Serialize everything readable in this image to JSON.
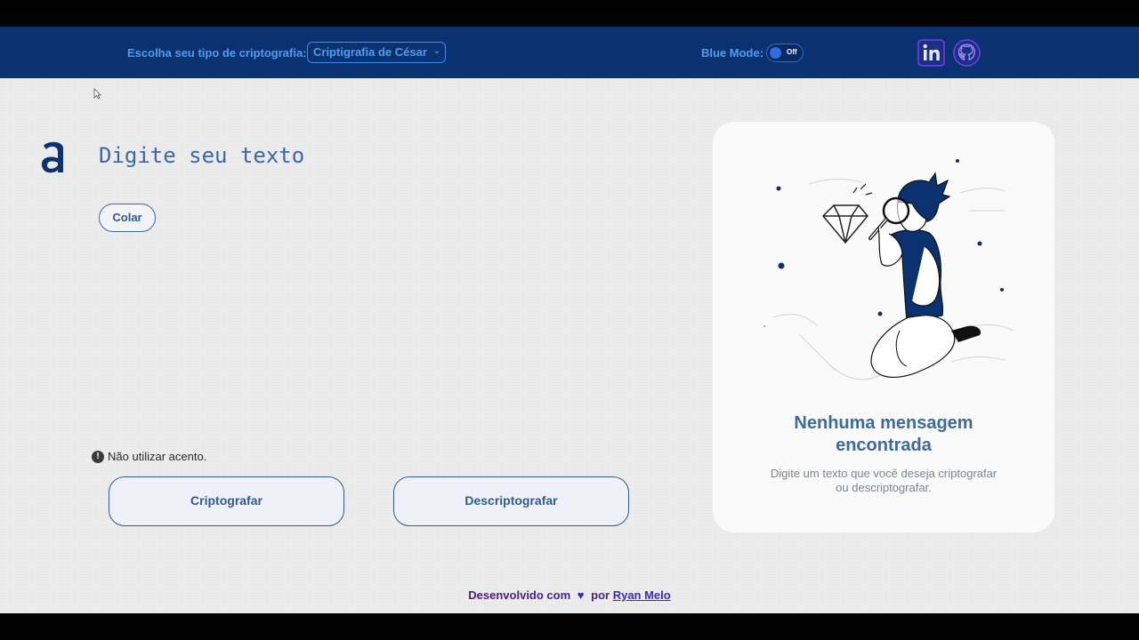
{
  "header": {
    "crypto_label": "Escolha seu tipo de criptografia:",
    "crypto_selected": "Criptigrafia de César",
    "blue_mode_label": "Blue Mode:",
    "toggle_state": "Off"
  },
  "main": {
    "text_placeholder": "Digite seu texto",
    "paste_label": "Colar",
    "warning_text": "Não utilizar acento.",
    "encrypt_label": "Criptografar",
    "decrypt_label": "Descriptografar"
  },
  "card": {
    "title_line1": "Nenhuma mensagem",
    "title_line2": "encontrada",
    "sub_line1": "Digite um texto que você deseja criptografar",
    "sub_line2": "ou descriptografar."
  },
  "footer": {
    "prefix": "Desenvolvido com",
    "by": "por",
    "author": "Ryan Melo"
  },
  "icons": [
    "logo-a-icon",
    "chevron-down-icon",
    "linkedin-icon",
    "github-icon",
    "warning-icon",
    "heart-icon",
    "cursor-icon"
  ],
  "colors": {
    "header_bg": "#0a3270",
    "accent": "#4f9cf0",
    "primary_text": "#2f5a94",
    "page_bg": "#ececec"
  }
}
